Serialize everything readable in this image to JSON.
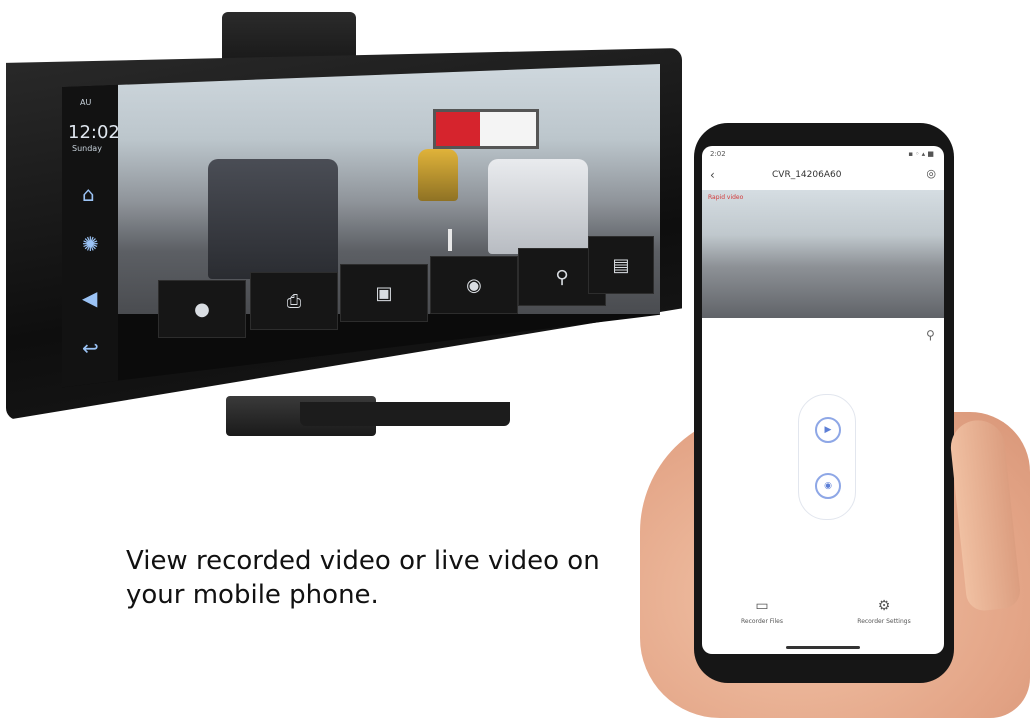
{
  "dashcam": {
    "date": "AU",
    "time": "12:02",
    "day": "Sunday",
    "side_icons": [
      "home-icon",
      "brightness-icon",
      "volume-icon",
      "back-icon"
    ],
    "bottom_buttons": [
      "record-icon",
      "snapshot-icon",
      "photo-icon",
      "mode-icon",
      "settings-icon",
      "microphone-icon",
      "file-icon"
    ]
  },
  "phone": {
    "status_time": "2:02",
    "status_icons": "▪ ◦ ▴ ■",
    "title": "CVR_14206A60",
    "rec_label": "Rapid video",
    "nav": [
      {
        "label": "Recorder Files",
        "icon": "folder-icon"
      },
      {
        "label": "Recorder Settings",
        "icon": "gear-icon"
      }
    ]
  },
  "caption": "View recorded video or live video on your mobile phone."
}
